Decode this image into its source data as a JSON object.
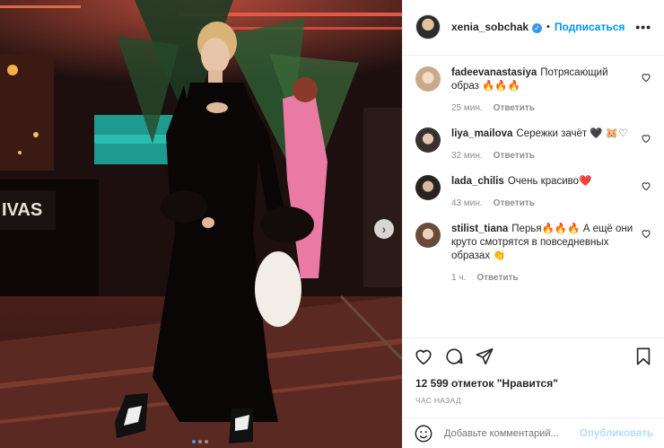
{
  "photo": {
    "sign_text": "IVAS",
    "carousel": {
      "count": 3,
      "active_index": 0
    }
  },
  "header": {
    "username": "xenia_sobchak",
    "separator": "•",
    "follow_label": "Подписаться",
    "more_label": "•••"
  },
  "comments": [
    {
      "user": "fadeevanastasiya",
      "text": "Потрясающий образ 🔥🔥🔥",
      "time": "25 мин.",
      "reply": "Ответить"
    },
    {
      "user": "liya_mailova",
      "text": "Сережки зачёт 🖤 🐹♡",
      "time": "32 мин.",
      "reply": "Ответить"
    },
    {
      "user": "lada_chilis",
      "text": "Очень красиво❤️",
      "time": "43 мин.",
      "reply": "Ответить"
    },
    {
      "user": "stilist_tiana",
      "text": "Перья🔥🔥🔥 А ещё они круто смотрятся в повседневных образах 👏",
      "time": "1 ч.",
      "reply": "Ответить"
    }
  ],
  "likes_text": "12 599 отметок \"Нравится\"",
  "time_ago": "ЧАС НАЗАД",
  "add_comment": {
    "placeholder": "Добавьте комментарий...",
    "publish_label": "Опубликовать"
  },
  "colors": {
    "accent": "#0095f6",
    "verified": "#3897f0",
    "publish_disabled": "#b2dffc",
    "muted": "#8e8e8e"
  }
}
